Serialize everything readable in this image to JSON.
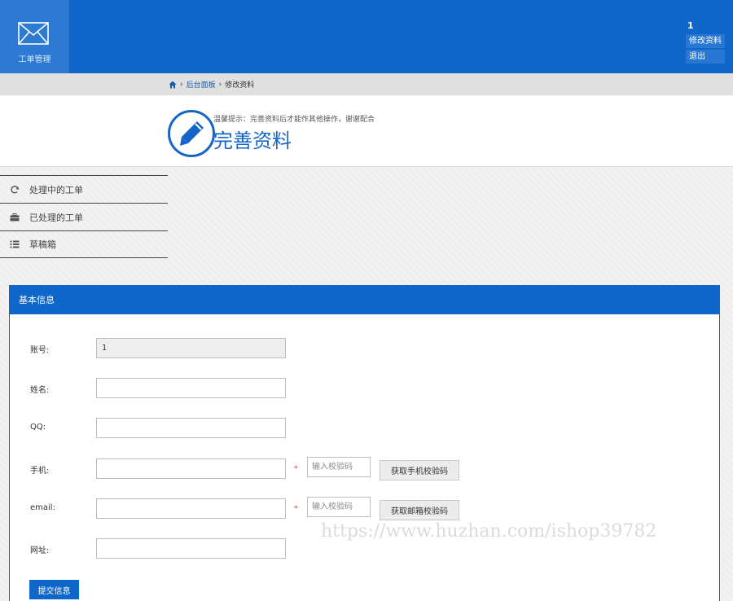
{
  "header": {
    "logo_text": "工单管理",
    "user_name": "1",
    "menu": [
      {
        "label": "修改资料"
      },
      {
        "label": "退出"
      }
    ]
  },
  "breadcrumb": {
    "home_icon": "home-icon",
    "items": [
      "后台面板",
      "修改资料"
    ],
    "separator": "›"
  },
  "title_section": {
    "tip": "温馨提示：完善资料后才能作其他操作，谢谢配合",
    "title": "完善资料",
    "icon": "pencil-icon"
  },
  "sidebar": {
    "items": [
      {
        "label": "处理中的工单",
        "icon": "refresh-icon"
      },
      {
        "label": "已处理的工单",
        "icon": "briefcase-icon"
      },
      {
        "label": "草稿箱",
        "icon": "list-icon"
      }
    ]
  },
  "form": {
    "header": "基本信息",
    "account_label": "账号:",
    "account_value": "1",
    "name_label": "姓名:",
    "qq_label": "QQ:",
    "phone_label": "手机:",
    "phone_code_placeholder": "输入校验码",
    "phone_code_button": "获取手机校验码",
    "email_label": "email:",
    "email_code_placeholder": "输入校验码",
    "email_code_button": "获取邮箱校验码",
    "website_label": "网址:",
    "required_mark": "*",
    "submit_label": "提交信息"
  },
  "watermark": "https://www.huzhan.com/ishop39782",
  "colors": {
    "primary": "#0f67c9",
    "logo_block": "#2d7ad3",
    "breadcrumb_bg": "#e0e0e0",
    "required": "#dd3333"
  }
}
